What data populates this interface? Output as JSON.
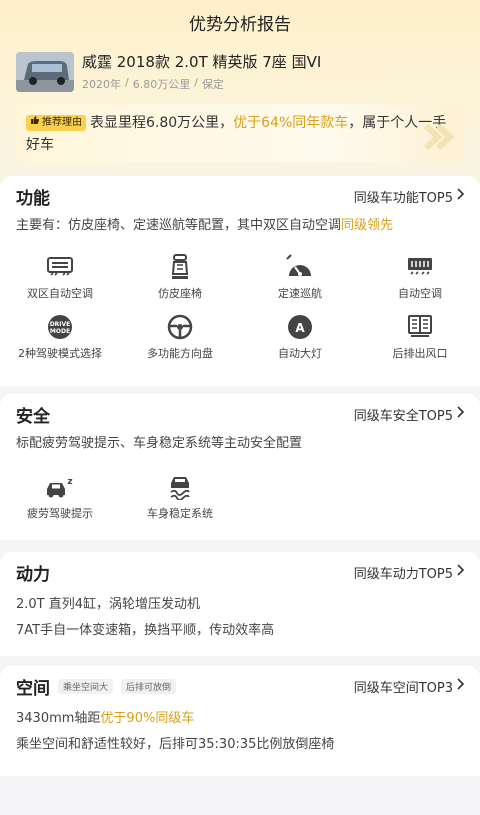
{
  "header": {
    "title": "优势分析报告"
  },
  "car": {
    "title": "威霆 2018款 2.0T 精英版 7座 国VI",
    "year": "2020年",
    "mileage": "6.80万公里",
    "sep1": "/",
    "sep2": "/",
    "location": "保定"
  },
  "reason": {
    "badge": "推荐理由",
    "text1": "表显里程6.80万公里，",
    "highlight": "优于64%同年款车",
    "text2": "，属于个人一手好车"
  },
  "sections": {
    "function": {
      "title": "功能",
      "more": "同级车功能TOP5",
      "desc": "主要有：仿皮座椅、定速巡航等配置，其中双区自动空调",
      "desc_hl": "同级领先",
      "items": [
        {
          "label": "双区自动空调",
          "icon": "dual-zone-ac-icon"
        },
        {
          "label": "仿皮座椅",
          "icon": "seat-icon"
        },
        {
          "label": "定速巡航",
          "icon": "cruise-control-icon"
        },
        {
          "label": "自动空调",
          "icon": "auto-ac-icon"
        },
        {
          "label": "2种驾驶模式选择",
          "icon": "drive-mode-icon"
        },
        {
          "label": "多功能方向盘",
          "icon": "steering-wheel-icon"
        },
        {
          "label": "自动大灯",
          "icon": "auto-headlight-icon"
        },
        {
          "label": "后排出风口",
          "icon": "rear-vent-icon"
        }
      ]
    },
    "safety": {
      "title": "安全",
      "more": "同级车安全TOP5",
      "desc": "标配疲劳驾驶提示、车身稳定系统等主动安全配置",
      "items": [
        {
          "label": "疲劳驾驶提示",
          "icon": "fatigue-alert-icon"
        },
        {
          "label": "车身稳定系统",
          "icon": "stability-control-icon"
        }
      ]
    },
    "power": {
      "title": "动力",
      "more": "同级车动力TOP5",
      "line1": "2.0T 直列4缸，涡轮增压发动机",
      "line2": "7AT手自一体变速箱，换挡平顺，传动效率高"
    },
    "space": {
      "title": "空间",
      "tag1": "乘坐空间大",
      "tag2": "后排可放倒",
      "more": "同级车空间TOP3",
      "line1a": "3430mm轴距",
      "line1_hl": "优于90%同级车",
      "line2": "乘坐空间和舒适性较好，后排可35:30:35比例放倒座椅"
    }
  },
  "colors": {
    "accent": "#d9a018",
    "badge": "#fbd04e"
  },
  "drive_mode_icon_text": "DRIVE MODE"
}
